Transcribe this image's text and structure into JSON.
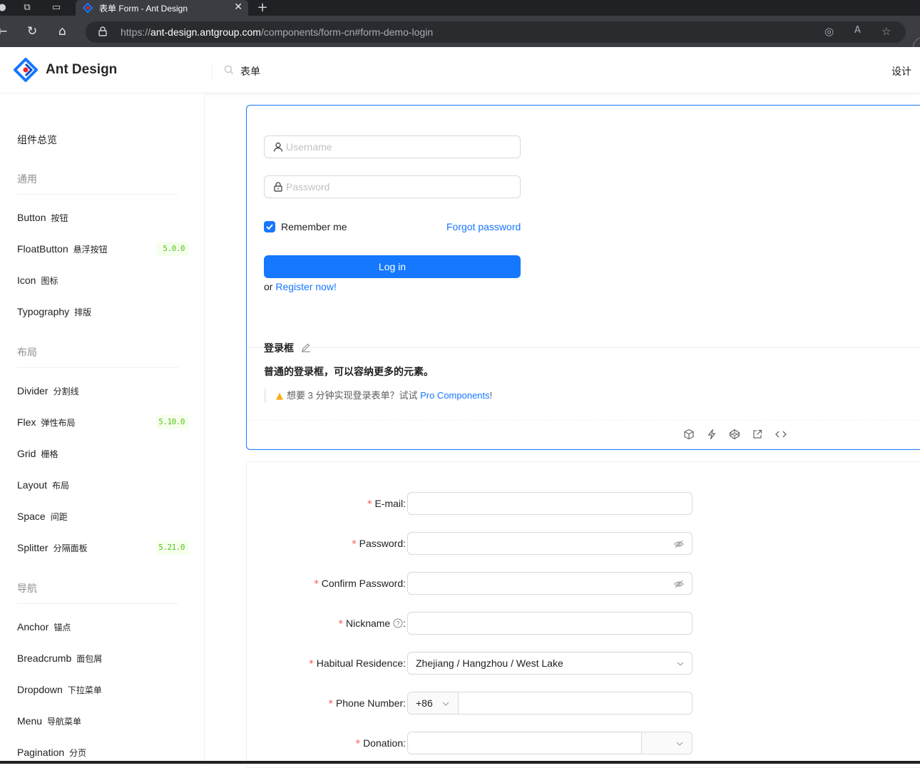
{
  "browser": {
    "tab_title": "表单 Form - Ant Design",
    "url_prefix": "https://",
    "url_host": "ant-design.antgroup.com",
    "url_path": "/components/form-cn#form-demo-login"
  },
  "header": {
    "brand": "Ant Design",
    "search_value": "表单",
    "right_nav": "设计"
  },
  "sidebar": {
    "overview": "组件总览",
    "groups": {
      "general": "通用",
      "layout": "布局",
      "navigation": "导航"
    },
    "items": [
      {
        "en": "Button",
        "cn": "按钮"
      },
      {
        "en": "FloatButton",
        "cn": "悬浮按钮",
        "badge": "5.0.0"
      },
      {
        "en": "Icon",
        "cn": "图标"
      },
      {
        "en": "Typography",
        "cn": "排版"
      },
      {
        "en": "Divider",
        "cn": "分割线"
      },
      {
        "en": "Flex",
        "cn": "弹性布局",
        "badge": "5.10.0"
      },
      {
        "en": "Grid",
        "cn": "栅格"
      },
      {
        "en": "Layout",
        "cn": "布局"
      },
      {
        "en": "Space",
        "cn": "间距"
      },
      {
        "en": "Splitter",
        "cn": "分隔面板",
        "badge": "5.21.0"
      },
      {
        "en": "Anchor",
        "cn": "锚点"
      },
      {
        "en": "Breadcrumb",
        "cn": "面包屑"
      },
      {
        "en": "Dropdown",
        "cn": "下拉菜单"
      },
      {
        "en": "Menu",
        "cn": "导航菜单"
      },
      {
        "en": "Pagination",
        "cn": "分页"
      }
    ],
    "badge_color": "#52c41a"
  },
  "login_demo": {
    "username_placeholder": "Username",
    "password_placeholder": "Password",
    "remember_label": "Remember me",
    "remember_checked": true,
    "forgot_link": "Forgot password",
    "login_button": "Log in",
    "or_text": "or",
    "register_link": "Register now!",
    "title": "登录框",
    "description": "普通的登录框，可以容纳更多的元素。",
    "tip_text": "想要 3 分钟实现登录表单？试试",
    "tip_link": "Pro Components",
    "tip_end": "!",
    "primary_color": "#1677ff"
  },
  "register_demo": {
    "email_label": "E-mail",
    "password_label": "Password",
    "confirm_label": "Confirm Password",
    "nickname_label": "Nickname",
    "residence_label": "Habitual Residence",
    "residence_value": "Zhejiang / Hangzhou / West Lake",
    "phone_label": "Phone Number",
    "phone_prefix": "+86",
    "donation_label": "Donation",
    "colon": ":"
  }
}
